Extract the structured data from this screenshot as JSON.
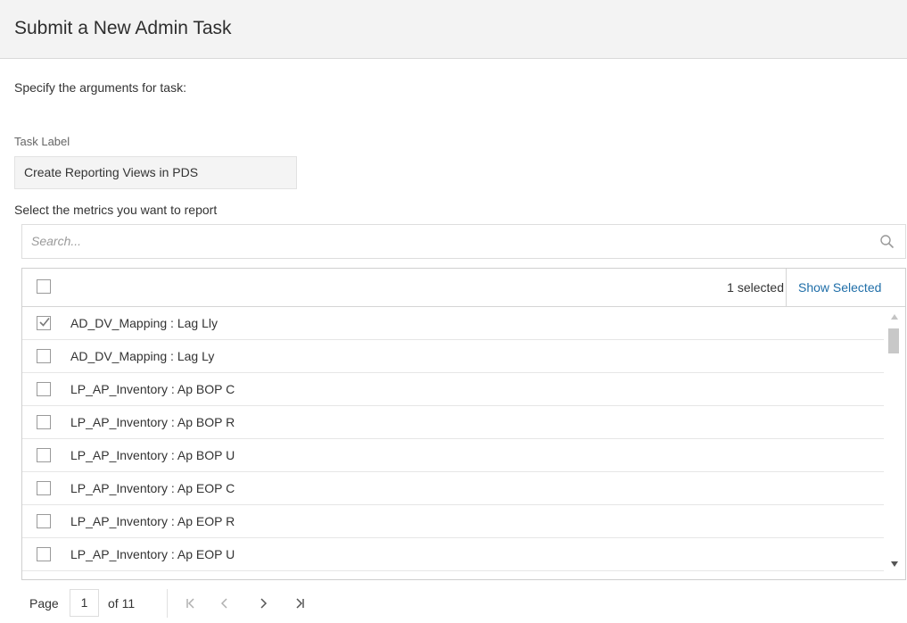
{
  "header": {
    "title": "Submit a New Admin Task"
  },
  "instructions": "Specify the arguments for task:",
  "task_label": {
    "label": "Task Label",
    "value": "Create Reporting Views in PDS"
  },
  "metrics": {
    "label": "Select the metrics you want to report",
    "search_placeholder": "Search...",
    "selected_count": "1 selected",
    "show_selected": "Show Selected",
    "rows": [
      {
        "label": "AD_DV_Mapping : Lag Lly",
        "checked": true
      },
      {
        "label": "AD_DV_Mapping : Lag Ly",
        "checked": false
      },
      {
        "label": "LP_AP_Inventory : Ap BOP C",
        "checked": false
      },
      {
        "label": "LP_AP_Inventory : Ap BOP R",
        "checked": false
      },
      {
        "label": "LP_AP_Inventory : Ap BOP U",
        "checked": false
      },
      {
        "label": "LP_AP_Inventory : Ap EOP C",
        "checked": false
      },
      {
        "label": "LP_AP_Inventory : Ap EOP R",
        "checked": false
      },
      {
        "label": "LP_AP_Inventory : Ap EOP U",
        "checked": false
      },
      {
        "label": "",
        "checked": false
      }
    ]
  },
  "pagination": {
    "page_word": "Page",
    "current_page": "1",
    "of_label": "of 11"
  },
  "colors": {
    "accent": "#1f6ea8",
    "header_bg": "#f3f3f3"
  },
  "icons": [
    "search-icon",
    "check-icon",
    "first-page-icon",
    "prev-page-icon",
    "next-page-icon",
    "last-page-icon"
  ]
}
